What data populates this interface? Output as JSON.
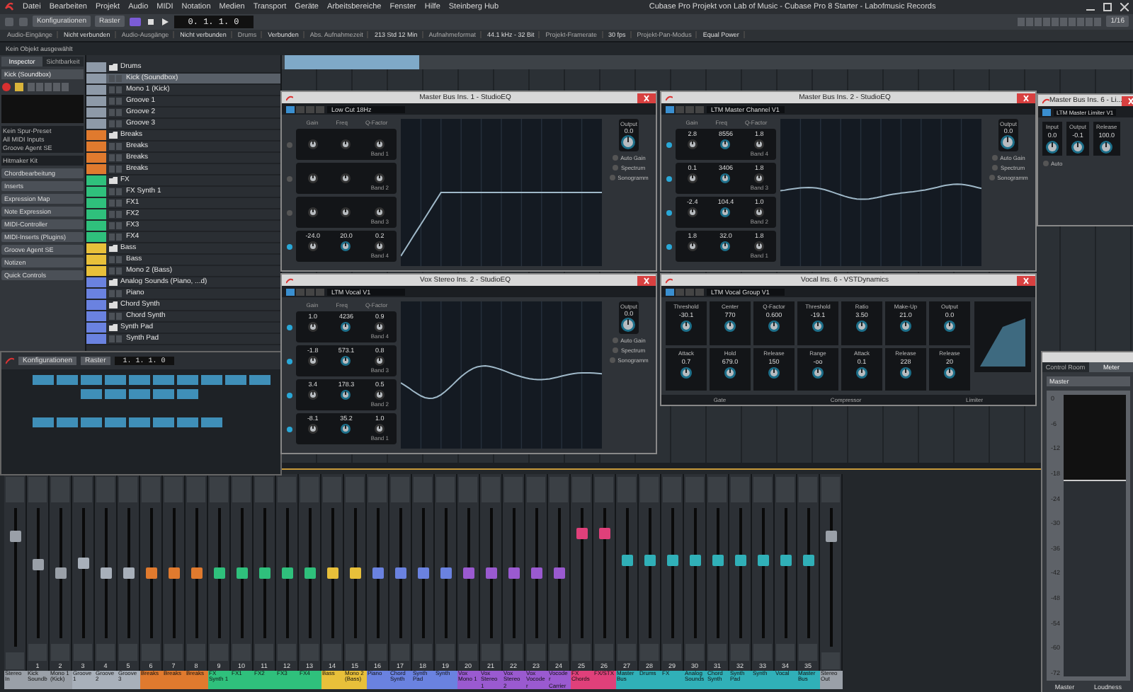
{
  "menu": {
    "items": [
      "Datei",
      "Bearbeiten",
      "Projekt",
      "Audio",
      "MIDI",
      "Notation",
      "Medien",
      "Transport",
      "Geräte",
      "Arbeitsbereiche",
      "Fenster",
      "Hilfe",
      "Steinberg Hub"
    ],
    "title": "Cubase Pro Projekt von Lab of Music - Cubase Pro 8 Starter - Labofmusic Records"
  },
  "toolbar": {
    "dropdowns": [
      "Konfigurationen",
      "Raster"
    ],
    "time": "0. 1. 1. 0",
    "quantize": "1/16"
  },
  "info_line": [
    "Audio-Eingänge",
    "Nicht verbunden",
    "Audio-Ausgänge",
    "Nicht verbunden",
    "Drums",
    "Verbunden",
    "Abs. Aufnahmezeit",
    "213 Std 12 Min",
    "Aufnahmeformat",
    "44.1 kHz - 32 Bit",
    "Projekt-Framerate",
    "30 fps",
    "Projekt-Pan-Modus",
    "Equal Power"
  ],
  "status": "Kein Objekt ausgewählt",
  "inspector": {
    "tabs": [
      {
        "label": "Inspector",
        "selected": true
      },
      {
        "label": "Sichtbarkeit",
        "selected": false
      }
    ],
    "track_name": "Kick (Soundbox)",
    "routing": [
      "Kein Spur-Preset",
      "All MIDI Inputs",
      "Groove Agent SE"
    ],
    "instrument": "Hitmaker Kit",
    "sections": [
      "Chordbearbeitung",
      "Inserts",
      "Expression Map",
      "Note Expression",
      "MIDI-Controller",
      "MIDI-Inserts (Plugins)",
      "Groove Agent SE",
      "Notizen",
      "Quick Controls"
    ]
  },
  "tracks": [
    {
      "name": "Drums",
      "kind": "folder",
      "color": "#8e9aa8",
      "selected": false
    },
    {
      "name": "Kick (Soundbox)",
      "kind": "track",
      "color": "#8e9aa8",
      "selected": true
    },
    {
      "name": "Mono 1 (Kick)",
      "kind": "track",
      "color": "#8e9aa8",
      "selected": false
    },
    {
      "name": "Groove 1",
      "kind": "track",
      "color": "#8e9aa8",
      "selected": false
    },
    {
      "name": "Groove 2",
      "kind": "track",
      "color": "#8e9aa8",
      "selected": false
    },
    {
      "name": "Groove 3",
      "kind": "track",
      "color": "#8e9aa8",
      "selected": false
    },
    {
      "name": "Breaks",
      "kind": "folder",
      "color": "#e07a2e",
      "selected": false
    },
    {
      "name": "Breaks",
      "kind": "track",
      "color": "#e07a2e",
      "selected": false
    },
    {
      "name": "Breaks",
      "kind": "track",
      "color": "#e07a2e",
      "selected": false
    },
    {
      "name": "Breaks",
      "kind": "track",
      "color": "#e07a2e",
      "selected": false
    },
    {
      "name": "FX",
      "kind": "folder",
      "color": "#2fc07c",
      "selected": false
    },
    {
      "name": "FX Synth 1",
      "kind": "track",
      "color": "#2fc07c",
      "selected": false
    },
    {
      "name": "FX1",
      "kind": "track",
      "color": "#2fc07c",
      "selected": false
    },
    {
      "name": "FX2",
      "kind": "track",
      "color": "#2fc07c",
      "selected": false
    },
    {
      "name": "FX3",
      "kind": "track",
      "color": "#2fc07c",
      "selected": false
    },
    {
      "name": "FX4",
      "kind": "track",
      "color": "#2fc07c",
      "selected": false
    },
    {
      "name": "Bass",
      "kind": "folder",
      "color": "#e8c03a",
      "selected": false
    },
    {
      "name": "Bass",
      "kind": "track",
      "color": "#e8c03a",
      "selected": false
    },
    {
      "name": "Mono 2 (Bass)",
      "kind": "track",
      "color": "#e8c03a",
      "selected": false
    },
    {
      "name": "Analog Sounds (Piano, ...d)",
      "kind": "folder",
      "color": "#6a82e0",
      "selected": false
    },
    {
      "name": "Piano",
      "kind": "track",
      "color": "#6a82e0",
      "selected": false
    },
    {
      "name": "Chord Synth",
      "kind": "folder",
      "color": "#6a82e0",
      "selected": false
    },
    {
      "name": "Chord Synth",
      "kind": "track",
      "color": "#6a82e0",
      "selected": false
    },
    {
      "name": "Synth Pad",
      "kind": "folder",
      "color": "#6a82e0",
      "selected": false
    },
    {
      "name": "Synth Pad",
      "kind": "track",
      "color": "#6a82e0",
      "selected": false
    }
  ],
  "windows": [
    {
      "kind": "eq",
      "title": "Master Bus Ins. 1 - StudioEQ",
      "preset": "Low Cut 18Hz",
      "columns": [
        "Gain",
        "Freq",
        "Q-Factor"
      ],
      "output_label": "Output",
      "output_value": "0.0",
      "options": [
        "Auto Gain",
        "Spectrum",
        "Sonogramm"
      ],
      "bands": [
        {
          "on": false,
          "label": "Band 1"
        },
        {
          "on": false,
          "label": "Band 2"
        },
        {
          "on": false,
          "label": "Band 3"
        },
        {
          "on": true,
          "label": "Band 4",
          "gain": "-24.0",
          "freq": "20.0",
          "q": "0.2"
        }
      ]
    },
    {
      "kind": "eq",
      "title": "Master Bus Ins. 2 - StudioEQ",
      "preset": "LTM Master Channel V1",
      "columns": [
        "Gain",
        "Freq",
        "Q-Factor"
      ],
      "output_label": "Output",
      "output_value": "0.0",
      "options": [
        "Auto Gain",
        "Spectrum",
        "Sonogramm"
      ],
      "bands": [
        {
          "on": true,
          "label": "Band 4",
          "gain": "2.8",
          "freq": "8556",
          "q": "1.8"
        },
        {
          "on": true,
          "label": "Band 3",
          "gain": "0.1",
          "freq": "3406",
          "q": "1.8"
        },
        {
          "on": true,
          "label": "Band 2",
          "gain": "-2.4",
          "freq": "104.4",
          "q": "1.0"
        },
        {
          "on": true,
          "label": "Band 1",
          "gain": "1.8",
          "freq": "32.0",
          "q": "1.8"
        }
      ]
    },
    {
      "kind": "limiter",
      "title": "Master Bus Ins. 6 - Li...",
      "preset": "LTM Master Limiter V1",
      "params": [
        {
          "label": "Input",
          "value": "0.0"
        },
        {
          "label": "Output",
          "value": "-0.1"
        },
        {
          "label": "Release",
          "value": "100.0"
        }
      ],
      "auto": "Auto"
    },
    {
      "kind": "eq",
      "title": "Vox Stereo Ins. 2 - StudioEQ",
      "preset": "LTM Vocal V1",
      "columns": [
        "Gain",
        "Freq",
        "Q-Factor"
      ],
      "output_label": "Output",
      "output_value": "0.0",
      "options": [
        "Auto Gain",
        "Spectrum",
        "Sonogramm"
      ],
      "bands": [
        {
          "on": true,
          "label": "Band 4",
          "gain": "1.0",
          "freq": "4236",
          "q": "0.9"
        },
        {
          "on": true,
          "label": "Band 3",
          "gain": "-1.8",
          "freq": "573.1",
          "q": "0.8"
        },
        {
          "on": true,
          "label": "Band 2",
          "gain": "3.4",
          "freq": "178.3",
          "q": "0.5"
        },
        {
          "on": true,
          "label": "Band 1",
          "gain": "-8.1",
          "freq": "35.2",
          "q": "1.0"
        }
      ]
    },
    {
      "kind": "dynamics",
      "title": "Vocal Ins. 6 - VSTDynamics",
      "preset": "LTM Vocal Group V1",
      "params": [
        {
          "label": "Threshold",
          "value": "-30.1"
        },
        {
          "label": "Center",
          "value": "770"
        },
        {
          "label": "Q-Factor",
          "value": "0.600"
        },
        {
          "label": "Threshold",
          "value": "-19.1"
        },
        {
          "label": "Ratio",
          "value": "3.50"
        },
        {
          "label": "Make-Up",
          "value": "21.0"
        },
        {
          "label": "Output",
          "value": "0.0"
        },
        {
          "label": "Attack",
          "value": "0.7"
        },
        {
          "label": "Hold",
          "value": "679.0"
        },
        {
          "label": "Release",
          "value": "150"
        },
        {
          "label": "Range",
          "value": "-oo"
        },
        {
          "label": "Attack",
          "value": "0.1"
        },
        {
          "label": "Release",
          "value": "228"
        },
        {
          "label": "Release",
          "value": "20"
        }
      ],
      "sections": [
        "Gate",
        "Compressor",
        "Limiter"
      ]
    }
  ],
  "lower_zone": {
    "dropdowns": [
      "Konfigurationen",
      "Raster"
    ],
    "time": "1. 1. 1. 0",
    "pattern_rows": [
      [
        true,
        true,
        true,
        true,
        true,
        true,
        true,
        true,
        true,
        true
      ],
      [
        false,
        false,
        true,
        true,
        true,
        true,
        true,
        false,
        false,
        false
      ],
      [
        false,
        false,
        false,
        false,
        false,
        false,
        false,
        false,
        false,
        false
      ],
      [
        true,
        true,
        true,
        true,
        true,
        true,
        true,
        true,
        false,
        false
      ]
    ]
  },
  "mixer": [
    {
      "name": "Stereo In",
      "color": "#9aa0a8",
      "level": 0.8
    },
    {
      "number": "1",
      "name": "Kick Soundb",
      "color": "#9aa0a8",
      "level": 0.57
    },
    {
      "number": "2",
      "name": "Mono 1 (Kick)",
      "color": "#9aa0a8",
      "level": 0.5
    },
    {
      "number": "3",
      "name": "Groove 1",
      "color": "#a8b0ba",
      "level": 0.58
    },
    {
      "number": "4",
      "name": "Groove 2",
      "color": "#a8b0ba",
      "level": 0.5
    },
    {
      "number": "5",
      "name": "Groove 3",
      "color": "#a8b0ba",
      "level": 0.5
    },
    {
      "number": "6",
      "name": "Breaks",
      "color": "#e07a2e",
      "level": 0.5
    },
    {
      "number": "7",
      "name": "Breaks",
      "color": "#e07a2e",
      "level": 0.5
    },
    {
      "number": "8",
      "name": "Breaks",
      "color": "#e07a2e",
      "level": 0.5
    },
    {
      "number": "9",
      "name": "FX Synth 1",
      "color": "#2fc07c",
      "level": 0.5
    },
    {
      "number": "10",
      "name": "FX1",
      "color": "#2fc07c",
      "level": 0.5
    },
    {
      "number": "11",
      "name": "FX2",
      "color": "#2fc07c",
      "level": 0.5
    },
    {
      "number": "12",
      "name": "FX3",
      "color": "#2fc07c",
      "level": 0.5
    },
    {
      "number": "13",
      "name": "FX4",
      "color": "#2fc07c",
      "level": 0.5
    },
    {
      "number": "14",
      "name": "Bass",
      "color": "#e8c03a",
      "level": 0.5
    },
    {
      "number": "15",
      "name": "Mono 2 (Bass)",
      "color": "#e8c03a",
      "level": 0.5
    },
    {
      "number": "16",
      "name": "Piano",
      "color": "#6a82e0",
      "level": 0.5
    },
    {
      "number": "17",
      "name": "Chord Synth",
      "color": "#6a82e0",
      "level": 0.5
    },
    {
      "number": "18",
      "name": "Synth Pad",
      "color": "#6a82e0",
      "level": 0.5
    },
    {
      "number": "19",
      "name": "Synth",
      "color": "#6a82e0",
      "level": 0.5
    },
    {
      "number": "20",
      "name": "Vox Mono 1",
      "color": "#9a5ad0",
      "level": 0.5
    },
    {
      "number": "21",
      "name": "Vox Stereo 1",
      "color": "#9a5ad0",
      "level": 0.5
    },
    {
      "number": "22",
      "name": "Vox Stereo 2",
      "color": "#9a5ad0",
      "level": 0.5
    },
    {
      "number": "23",
      "name": "Vox Vocoder",
      "color": "#9a5ad0",
      "level": 0.5
    },
    {
      "number": "24",
      "name": "Vocoder Carrier",
      "color": "#9a5ad0",
      "level": 0.5
    },
    {
      "number": "25",
      "name": "FX Chords",
      "color": "#e0407a",
      "level": 0.8
    },
    {
      "number": "26",
      "name": "FX/STX",
      "color": "#e0407a",
      "level": 0.8
    },
    {
      "number": "27",
      "name": "Master Bus",
      "color": "#30b0b8",
      "level": 0.6
    },
    {
      "number": "28",
      "name": "Drums",
      "color": "#30b0b8",
      "level": 0.6
    },
    {
      "number": "29",
      "name": "FX",
      "color": "#30b0b8",
      "level": 0.6
    },
    {
      "number": "30",
      "name": "Analog Sounds",
      "color": "#30b0b8",
      "level": 0.6
    },
    {
      "number": "31",
      "name": "Chord Synth",
      "color": "#30b0b8",
      "level": 0.6
    },
    {
      "number": "32",
      "name": "Synth Pad",
      "color": "#30b0b8",
      "level": 0.6
    },
    {
      "number": "33",
      "name": "Synth",
      "color": "#30b0b8",
      "level": 0.6
    },
    {
      "number": "34",
      "name": "Vocal",
      "color": "#30b0b8",
      "level": 0.6
    },
    {
      "number": "35",
      "name": "Master Bus",
      "color": "#30b0b8",
      "level": 0.6
    },
    {
      "name": "Stereo Out",
      "color": "#9aa0a8",
      "level": 0.8
    }
  ],
  "control_room": {
    "tabs": [
      {
        "label": "Control Room",
        "selected": false
      },
      {
        "label": "Meter",
        "selected": true
      }
    ],
    "source": "Master",
    "scale": [
      "0",
      "-6",
      "-12",
      "-18",
      "-24",
      "-30",
      "-36",
      "-42",
      "-48",
      "-54",
      "-60",
      "-72"
    ],
    "level": 0.7,
    "footer": [
      "Master",
      "Loudness"
    ]
  }
}
